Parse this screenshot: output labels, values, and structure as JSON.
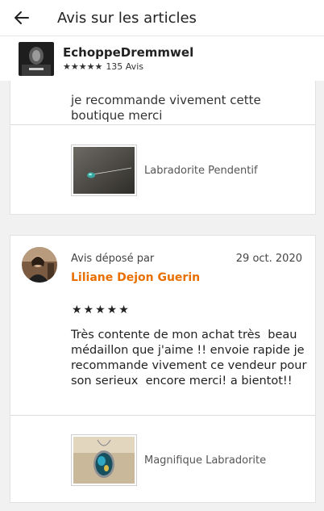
{
  "header": {
    "title": "Avis sur les articles"
  },
  "shop": {
    "name": "EchoppeDremmwel",
    "stars": "★★★★★",
    "review_count": "135 Avis"
  },
  "reviews": [
    {
      "text_tail": "je recommande vivement cette boutique merci",
      "product": {
        "name": "Labradorite Pendentif"
      }
    },
    {
      "posted_label": "Avis déposé par",
      "reviewer": "Liliane Dejon Guerin",
      "date": "29 oct. 2020",
      "stars": "★★★★★",
      "text": "Très contente de mon achat très  beau médaillon que j'aime !! envoie rapide je recommande vivement ce vendeur pour son serieux  encore merci! a bientot!!",
      "product": {
        "name": "Magnifique Labradorite"
      }
    }
  ],
  "colors": {
    "reviewer_name": "#e86f00",
    "background": "#f1f1f1"
  }
}
